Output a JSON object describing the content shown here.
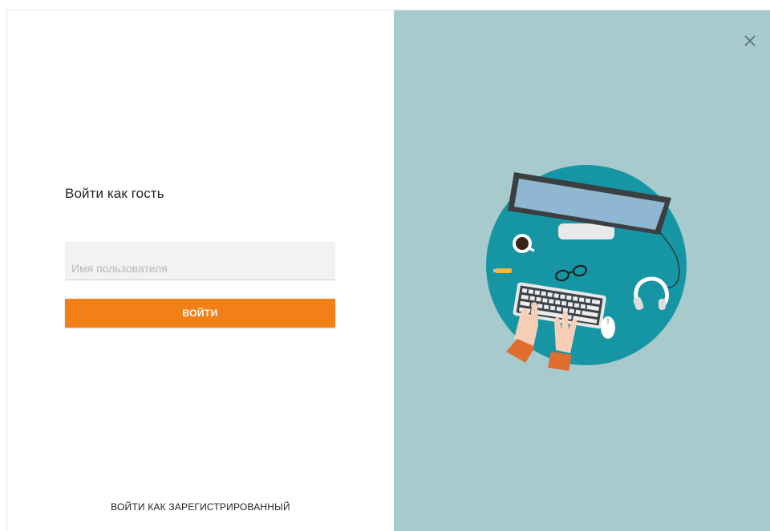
{
  "login": {
    "title": "Войти как гость",
    "username_placeholder": "Имя пользователя",
    "username_value": "",
    "submit_label": "ВОЙТИ",
    "registered_link": "ВОЙТИ КАК ЗАРЕГИСТРИРОВАННЫЙ"
  },
  "panel": {
    "close_icon": "close-icon",
    "illustration": "workspace-illustration",
    "accent_color": "#f28019",
    "side_background": "#a7cbcd"
  }
}
